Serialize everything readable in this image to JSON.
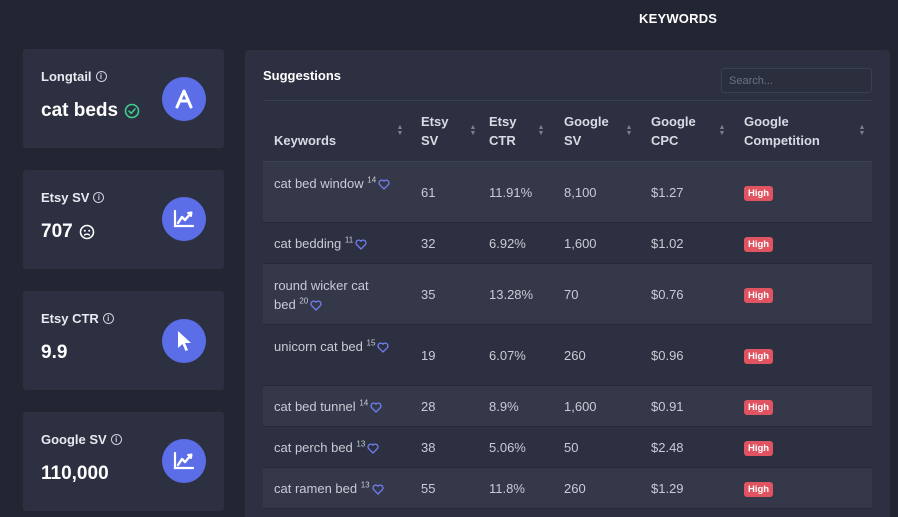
{
  "header": {
    "title": "KEYWORDS"
  },
  "stats": [
    {
      "label": "Longtail",
      "value": "cat beds",
      "icon": "letter-a-icon",
      "value_icon": "check-circle-icon"
    },
    {
      "label": "Etsy SV",
      "value": "707",
      "icon": "trend-chart-icon",
      "value_icon": "neutral-face-icon"
    },
    {
      "label": "Etsy CTR",
      "value": "9.9",
      "icon": "cursor-pointer-icon"
    },
    {
      "label": "Google SV",
      "value": "110,000",
      "icon": "trend-chart-icon"
    }
  ],
  "suggestions": {
    "title": "Suggestions",
    "search_placeholder": "Search...",
    "columns": [
      "Keywords",
      "Etsy SV",
      "Etsy CTR",
      "Google SV",
      "Google CPC",
      "Google Competition"
    ],
    "rows": [
      {
        "keyword": "cat bed window",
        "count": "14",
        "etsy_sv": "61",
        "etsy_ctr": "11.91%",
        "google_sv": "8,100",
        "google_cpc": "$1.27",
        "competition": "High"
      },
      {
        "keyword": "cat bedding",
        "count": "11",
        "etsy_sv": "32",
        "etsy_ctr": "6.92%",
        "google_sv": "1,600",
        "google_cpc": "$1.02",
        "competition": "High"
      },
      {
        "keyword": "round wicker cat bed",
        "count": "20",
        "etsy_sv": "35",
        "etsy_ctr": "13.28%",
        "google_sv": "70",
        "google_cpc": "$0.76",
        "competition": "High"
      },
      {
        "keyword": "unicorn cat bed",
        "count": "15",
        "etsy_sv": "19",
        "etsy_ctr": "6.07%",
        "google_sv": "260",
        "google_cpc": "$0.96",
        "competition": "High"
      },
      {
        "keyword": "cat bed tunnel",
        "count": "14",
        "etsy_sv": "28",
        "etsy_ctr": "8.9%",
        "google_sv": "1,600",
        "google_cpc": "$0.91",
        "competition": "High"
      },
      {
        "keyword": "cat perch bed",
        "count": "13",
        "etsy_sv": "38",
        "etsy_ctr": "5.06%",
        "google_sv": "50",
        "google_cpc": "$2.48",
        "competition": "High"
      },
      {
        "keyword": "cat ramen bed",
        "count": "13",
        "etsy_sv": "55",
        "etsy_ctr": "11.8%",
        "google_sv": "260",
        "google_cpc": "$1.29",
        "competition": "High"
      }
    ]
  },
  "colors": {
    "accent": "#5b6ee8",
    "badge_high": "#e05461",
    "heart": "#6f7ff0",
    "check": "#3ecf8e"
  }
}
